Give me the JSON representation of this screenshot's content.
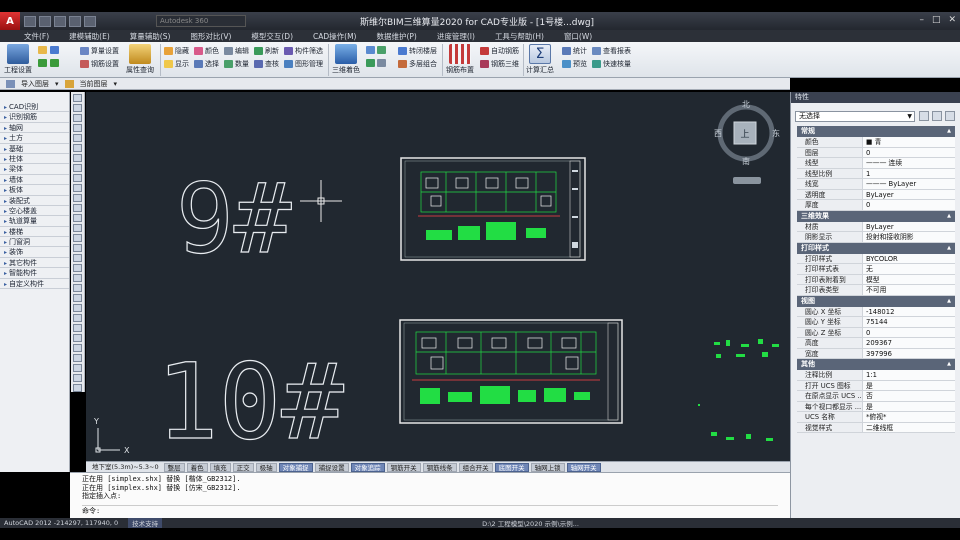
{
  "window": {
    "title": "斯维尔BIM三维算量2020 for CAD专业版 - [1号楼...dwg]",
    "search_placeholder": "Autodesk 360"
  },
  "menubar": [
    "文件(F)",
    "建模辅助(E)",
    "算量辅助(S)",
    "图形对比(V)",
    "模型交互(D)",
    "CAD操作(M)",
    "数据维护(P)",
    "进度管理(I)",
    "工具与帮助(H)",
    "窗口(W)"
  ],
  "ribbon": {
    "project_settings": "工程设置",
    "attribute_query": "属性查询",
    "calc_settings": "算量设置",
    "rebar_settings": "钢筋设置",
    "hide": "隐藏",
    "show": "显示",
    "color": "颜色",
    "select": "选择",
    "edit": "编辑",
    "quantity": "数量",
    "refresh": "刷新",
    "check": "查核",
    "comp_filter": "构件筛选",
    "graph_manage": "图形管理",
    "3d_color": "三维着色",
    "merge_frame": "转闭楼层",
    "multi_group": "多层组合",
    "rebar_layout": "钢筋布置",
    "auto_rebar": "自动钢筋",
    "rebar_3d": "钢筋三维",
    "calc_summary": "计算汇总",
    "stats": "统计",
    "preview": "预览",
    "view_report": "查看报表",
    "quick_check": "快速核量"
  },
  "toolbar2": {
    "import_layer": "导入图层",
    "current_layer": "当前图层"
  },
  "categories": [
    "CAD识别",
    "识别钢筋",
    "轴网",
    "土方",
    "基础",
    "柱体",
    "梁体",
    "墙体",
    "板体",
    "装配式",
    "空心楼盖",
    "轨道算量",
    "楼梯",
    "门窗洞",
    "装饰",
    "其它构件",
    "智能构件",
    "自定义构件"
  ],
  "drawing": {
    "label_top": "9#",
    "label_bottom": "10#",
    "compass": {
      "n": "北",
      "s": "南",
      "e": "东",
      "w": "西",
      "center": "上"
    },
    "ucs_x": "X",
    "ucs_y": "Y"
  },
  "statusbar": [
    {
      "label": "地下室(5.3m)~5.3~0",
      "on": false,
      "plain": true
    },
    {
      "label": "整层",
      "on": false
    },
    {
      "label": "着色",
      "on": false
    },
    {
      "label": "填充",
      "on": false
    },
    {
      "label": "正交",
      "on": false
    },
    {
      "label": "极轴",
      "on": false
    },
    {
      "label": "对象捕捉",
      "on": true
    },
    {
      "label": "捕捉设置",
      "on": false
    },
    {
      "label": "对象追踪",
      "on": true
    },
    {
      "label": "钢筋开关",
      "on": false
    },
    {
      "label": "钢筋线条",
      "on": false
    },
    {
      "label": "组合开关",
      "on": false
    },
    {
      "label": "底图开关",
      "on": true
    },
    {
      "label": "轴网上锁",
      "on": false
    },
    {
      "label": "轴网开关",
      "on": true
    }
  ],
  "command": {
    "lines": [
      "正在用 [simplex.shx] 替换 [楷体_GB2312].",
      "正在用 [simplex.shx] 替换 [仿宋_GB2312].",
      "指定插入点:"
    ],
    "prompt": "命令:"
  },
  "bottombar": {
    "coords": "AutoCAD 2012  -214297, 117940, 0",
    "tag": "技术支持",
    "right": "D:\\2 工程模型\\2020 示例\\示例..."
  },
  "properties": {
    "title": "特性",
    "selection": "无选择",
    "sections": [
      {
        "name": "常规",
        "rows": [
          [
            "颜色",
            "■ 青"
          ],
          [
            "图层",
            "0"
          ],
          [
            "线型",
            "——— 连续"
          ],
          [
            "线型比例",
            "1"
          ],
          [
            "线宽",
            "——— ByLayer"
          ],
          [
            "透明度",
            "ByLayer"
          ],
          [
            "厚度",
            "0"
          ]
        ]
      },
      {
        "name": "三维效果",
        "rows": [
          [
            "材质",
            "ByLayer"
          ],
          [
            "阴影显示",
            "投射和接收阴影"
          ]
        ]
      },
      {
        "name": "打印样式",
        "rows": [
          [
            "打印样式",
            "BYCOLOR"
          ],
          [
            "打印样式表",
            "无"
          ],
          [
            "打印表附着到",
            "模型"
          ],
          [
            "打印表类型",
            "不可用"
          ]
        ]
      },
      {
        "name": "视图",
        "rows": [
          [
            "圆心 X 坐标",
            "-148012"
          ],
          [
            "圆心 Y 坐标",
            "75144"
          ],
          [
            "圆心 Z 坐标",
            "0"
          ],
          [
            "高度",
            "209367"
          ],
          [
            "宽度",
            "397996"
          ]
        ]
      },
      {
        "name": "其他",
        "rows": [
          [
            "注释比例",
            "1:1"
          ],
          [
            "打开 UCS 图标",
            "是"
          ],
          [
            "在原点显示 UCS ...",
            "否"
          ],
          [
            "每个视口都显示 ...",
            "是"
          ],
          [
            "UCS 名称",
            "*俯视*"
          ],
          [
            "视觉样式",
            "二维线框"
          ]
        ]
      }
    ]
  },
  "colors": {
    "accent": "#6f86b6",
    "canvas": "#212830",
    "cad_green": "#22dd44"
  }
}
